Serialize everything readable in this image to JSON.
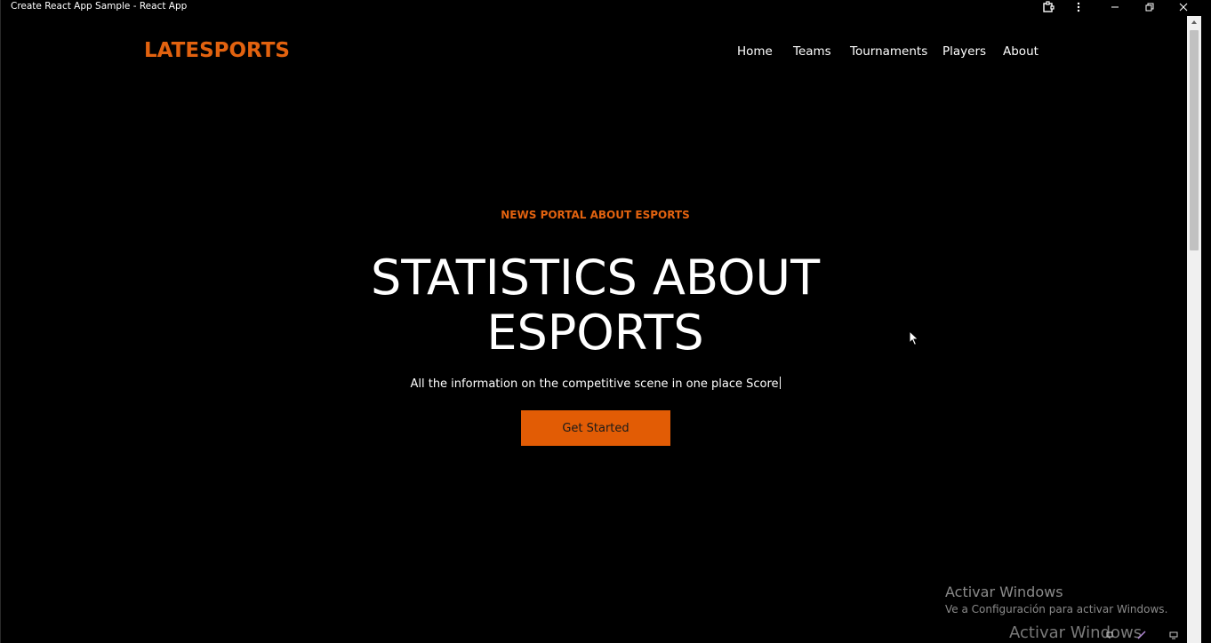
{
  "window": {
    "title": "Create React App Sample - React App"
  },
  "navbar": {
    "logo": "LATESPORTS",
    "links": [
      {
        "label": "Home"
      },
      {
        "label": "Teams"
      },
      {
        "label": "Tournaments"
      },
      {
        "label": "Players"
      },
      {
        "label": "About"
      }
    ]
  },
  "hero": {
    "eyebrow": "NEWS PORTAL ABOUT ESPORTS",
    "headline": "STATISTICS ABOUT ESPORTS",
    "subtitle": "All the information on the competitive scene in one place Score",
    "cta_label": "Get Started"
  },
  "watermark": {
    "title": "Activar Windows",
    "subtitle": "Ve a Configuración para activar Windows.",
    "title_repeat": "Activar Windows"
  },
  "colors": {
    "accent": "#e2620f",
    "background": "#000000",
    "text": "#ffffff"
  }
}
